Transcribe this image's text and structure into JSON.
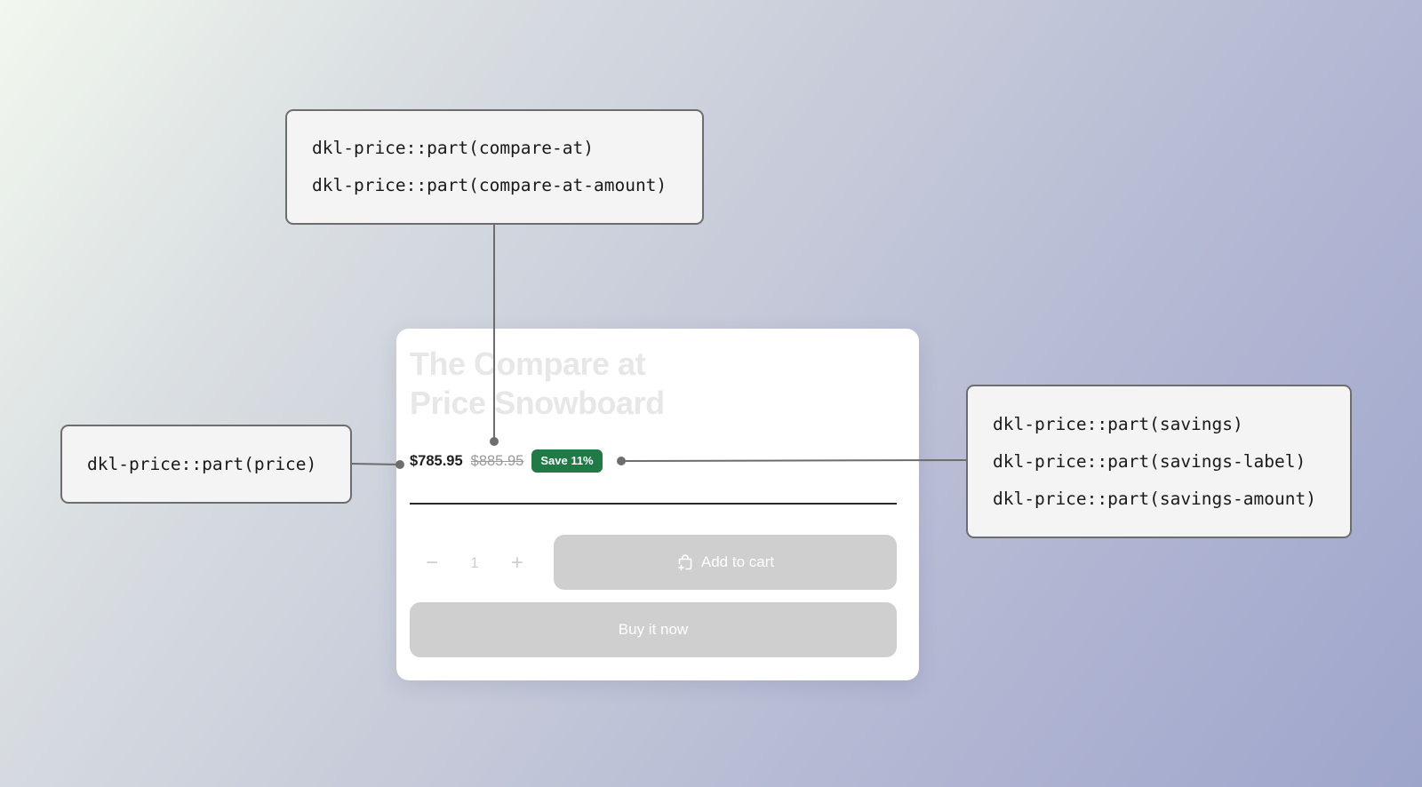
{
  "callouts": {
    "compare_at": [
      "dkl-price::part(compare-at)",
      "dkl-price::part(compare-at-amount)"
    ],
    "price": [
      "dkl-price::part(price)"
    ],
    "savings": [
      "dkl-price::part(savings)",
      "dkl-price::part(savings-label)",
      "dkl-price::part(savings-amount)"
    ]
  },
  "card": {
    "title": "The Compare at Price Snowboard",
    "price": "$785.95",
    "compare_at_price": "$885.95",
    "savings_label": "Save",
    "savings_amount": "11%",
    "quantity": "1",
    "minus_symbol": "−",
    "plus_symbol": "+",
    "add_to_cart_label": "Add to cart",
    "buy_now_label": "Buy it now"
  },
  "colors": {
    "savings_badge": "#1f7a45",
    "disabled_button": "#cfcfcf",
    "connector": "#6d6d6d"
  },
  "icons": [
    "bag-plus-icon"
  ]
}
